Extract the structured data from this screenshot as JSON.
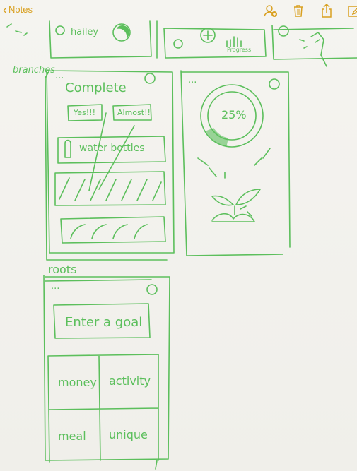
{
  "toolbar": {
    "back_label": "Notes",
    "icons": [
      "add-person-icon",
      "trash-icon",
      "share-icon",
      "compose-icon"
    ],
    "accent": "#d9a020"
  },
  "sketch": {
    "ink_color": "#5cbf5c",
    "top_strip": {
      "name_label": "hailey",
      "progress_label": "Progress"
    },
    "branches": {
      "section_label": "branches",
      "card1": {
        "dots": "...",
        "title": "Complete",
        "btn_yes": "Yes!!!",
        "btn_almost": "Almost!!",
        "item": "water bottles"
      },
      "card2": {
        "dots": "...",
        "percent": "25%"
      }
    },
    "roots": {
      "section_label": "roots",
      "dots": "...",
      "enter_goal": "Enter a goal",
      "grid": [
        "money",
        "activity",
        "meal",
        "unique"
      ]
    }
  }
}
